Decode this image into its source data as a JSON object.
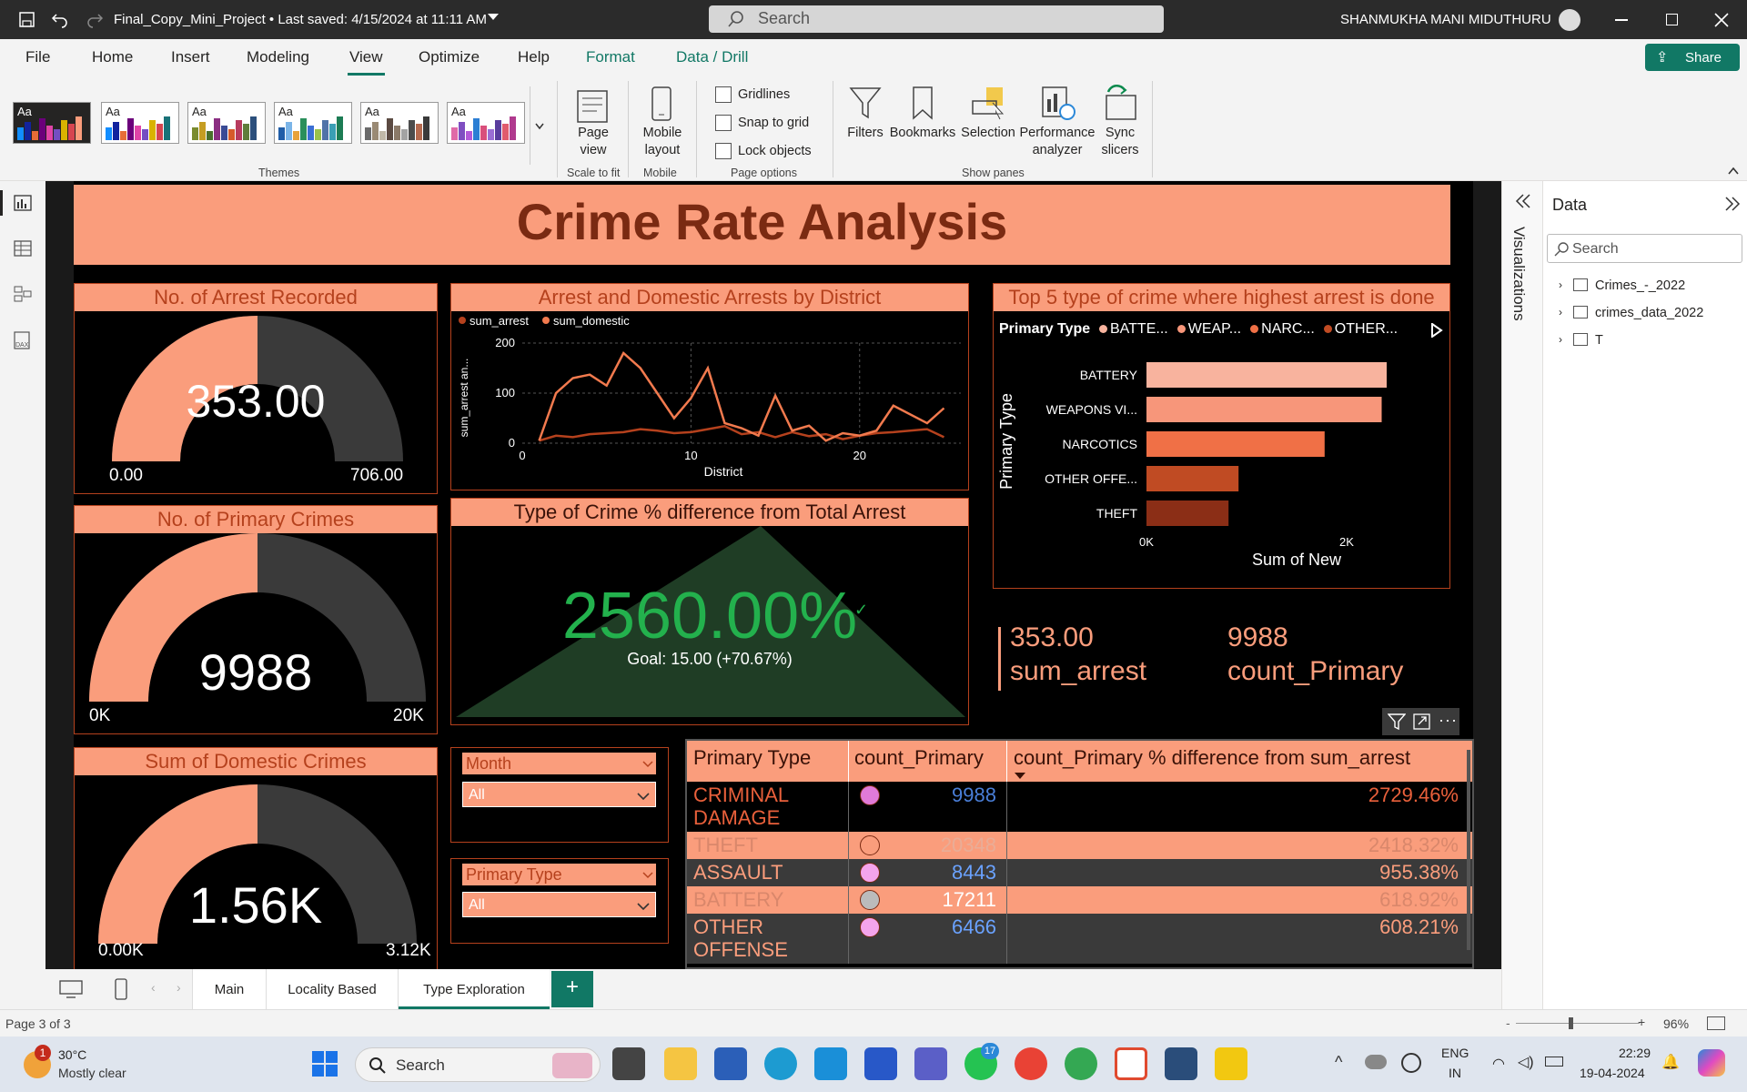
{
  "titlebar": {
    "title": "Final_Copy_Mini_Project • Last saved: 4/15/2024 at 11:11 AM",
    "search_placeholder": "Search",
    "user": "SHANMUKHA MANI MIDUTHURU"
  },
  "menu": {
    "file": "File",
    "home": "Home",
    "insert": "Insert",
    "modeling": "Modeling",
    "view": "View",
    "optimize": "Optimize",
    "help": "Help",
    "format": "Format",
    "data_drill": "Data / Drill",
    "share": "Share"
  },
  "ribbon": {
    "themes_label": "Themes",
    "page_view": "Page view",
    "scale_label": "Scale to fit",
    "mobile_layout": "Mobile layout",
    "mobile_label": "Mobile",
    "gridlines": "Gridlines",
    "snap": "Snap to grid",
    "lock": "Lock objects",
    "page_options_label": "Page options",
    "filters": "Filters",
    "bookmarks": "Bookmarks",
    "selection": "Selection",
    "performance": "Performance analyzer",
    "sync": "Sync slicers",
    "show_panes_label": "Show panes",
    "theme_aa": "Aa"
  },
  "report": {
    "title": "Crime Rate Analysis",
    "gauge1": {
      "title": "No. of Arrest Recorded",
      "value": "353.00",
      "min": "0.00",
      "max": "706.00",
      "fraction": 0.5
    },
    "gauge2": {
      "title": "No. of Primary Crimes",
      "value": "9988",
      "min": "0K",
      "max": "20K",
      "fraction": 0.5
    },
    "gauge3": {
      "title": "Sum of Domestic Crimes",
      "value": "1.56K",
      "min": "0.00K",
      "max": "3.12K",
      "fraction": 0.5
    },
    "kpi": {
      "title": "Type of Crime % difference from Total Arrest",
      "value": "2560.00%",
      "goal": "Goal: 15.00 (+70.67%)"
    },
    "cards": {
      "v1": "353.00",
      "l1": "sum_arrest",
      "v2": "9988",
      "l2": "count_Primary"
    },
    "slicer_month": {
      "title": "Month",
      "value": "All"
    },
    "slicer_type": {
      "title": "Primary Type",
      "value": "All"
    },
    "table": {
      "headers": [
        "Primary Type",
        "count_Primary",
        "count_Primary % difference from sum_arrest"
      ],
      "rows": [
        {
          "type": "CRIMINAL DAMAGE",
          "count": "9988",
          "pct": "2729.46%",
          "dot": "#e07ad8"
        },
        {
          "type": "THEFT",
          "count": "20348",
          "pct": "2418.32%",
          "dot": "#fa9d7c"
        },
        {
          "type": "ASSAULT",
          "count": "8443",
          "pct": "955.38%",
          "dot": "#f4a4ec"
        },
        {
          "type": "BATTERY",
          "count": "17211",
          "pct": "618.92%",
          "dot": "#bbbbbb"
        },
        {
          "type": "OTHER OFFENSE",
          "count": "6466",
          "pct": "608.21%",
          "dot": "#f4a4ec"
        }
      ]
    }
  },
  "chart_data": [
    {
      "type": "line",
      "title": "Arrest and Domestic Arrests by District",
      "xlabel": "District",
      "ylabel": "sum_arrest an...",
      "ylim": [
        0,
        200
      ],
      "xticks": [
        "0",
        "10",
        "20"
      ],
      "yticks": [
        "0",
        "100",
        "200"
      ],
      "x": [
        1,
        2,
        3,
        4,
        5,
        6,
        7,
        8,
        9,
        10,
        11,
        12,
        13,
        14,
        15,
        16,
        17,
        18,
        19,
        20,
        21,
        22,
        24,
        25
      ],
      "series": [
        {
          "name": "sum_arrest",
          "color": "#b5411d",
          "values": [
            5,
            15,
            12,
            18,
            20,
            22,
            28,
            25,
            20,
            22,
            28,
            34,
            18,
            22,
            12,
            22,
            14,
            18,
            8,
            15,
            20,
            22,
            28,
            12
          ]
        },
        {
          "name": "sum_domestic",
          "color": "#f27a4e",
          "values": [
            5,
            100,
            130,
            137,
            115,
            180,
            150,
            100,
            50,
            90,
            150,
            40,
            30,
            15,
            95,
            25,
            35,
            5,
            20,
            15,
            25,
            75,
            40,
            70
          ]
        }
      ]
    },
    {
      "type": "bar",
      "title": "Top 5 type of crime where highest arrest is done",
      "xlabel": "Sum of New",
      "ylabel": "Primary Type",
      "legend_title": "Primary Type",
      "legend": [
        "BATTE...",
        "WEAP...",
        "NARC...",
        "OTHER..."
      ],
      "categories": [
        "BATTERY",
        "WEAPONS VI...",
        "NARCOTICS",
        "OTHER OFFE...",
        "THEFT"
      ],
      "values": [
        2400,
        2350,
        1780,
        920,
        820
      ],
      "xticks": [
        "0K",
        "2K"
      ],
      "colors": [
        "#f8b39e",
        "#f7967a",
        "#f07046",
        "#c04b23",
        "#8b2e16"
      ]
    }
  ],
  "right_pane": {
    "title": "Data",
    "visualizations": "Visualizations",
    "search": "Search",
    "items": [
      "Crimes_-_2022",
      "crimes_data_2022",
      "T"
    ]
  },
  "pages": {
    "main": "Main",
    "locality": "Locality Based",
    "type": "Type Exploration",
    "add": "+"
  },
  "status": {
    "page": "Page 3 of 3",
    "zoom": "96%"
  },
  "taskbar": {
    "temp": "30°C",
    "weather": "Mostly clear",
    "search": "Search",
    "lang1": "ENG",
    "lang2": "IN",
    "time": "22:29",
    "date": "19-04-2024",
    "badge_weather": "1",
    "badge_teams": "17"
  }
}
